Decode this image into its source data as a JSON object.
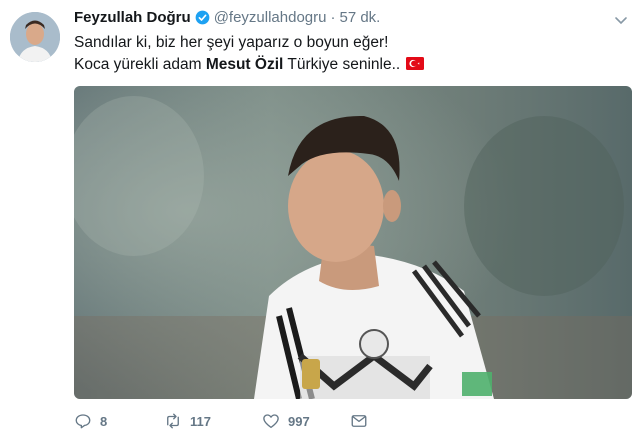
{
  "tweet": {
    "author_name": "Feyzullah Doğru",
    "handle": "@feyzullahdogru",
    "separator": "·",
    "time": "57 dk.",
    "line1": "Sandılar ki, biz her şeyi yaparız o boyun eğer!",
    "line2_before": "Koca yürekli adam ",
    "line2_bold": "Mesut Özil",
    "line2_after": " Türkiye seninle.."
  },
  "actions": {
    "reply_count": "8",
    "retweet_count": "117",
    "like_count": "997"
  },
  "colors": {
    "verified": "#1da1f2",
    "muted": "#657786",
    "flag_red": "#e30a17"
  },
  "icons": [
    "verified-badge-icon",
    "chevron-down-icon",
    "turkey-flag-icon",
    "reply-icon",
    "retweet-icon",
    "like-icon",
    "direct-message-icon"
  ]
}
